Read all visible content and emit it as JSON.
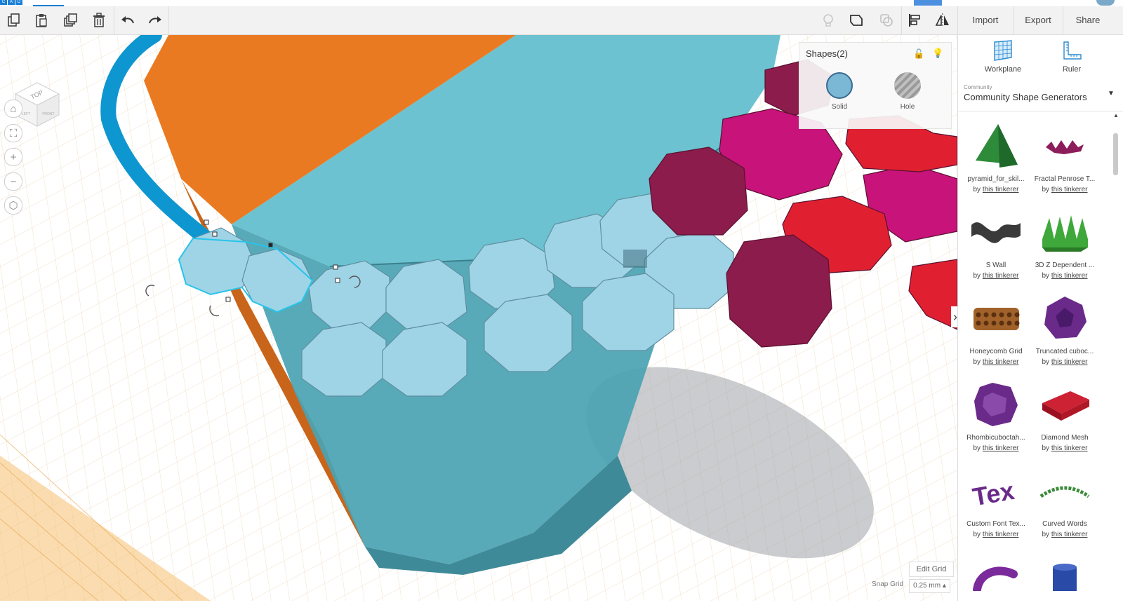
{
  "app": {
    "logo_letters": [
      "C",
      "A",
      "D"
    ]
  },
  "toolbar": {
    "copy_icon": "copy-icon",
    "paste_icon": "paste-icon",
    "duplicate_icon": "duplicate-icon",
    "delete_icon": "trash-icon",
    "undo_icon": "undo-icon",
    "redo_icon": "redo-icon",
    "import_label": "Import",
    "export_label": "Export",
    "share_label": "Share"
  },
  "viewport": {
    "viewcube_top_label": "TOP",
    "viewcube_left_label": "LEFT",
    "viewcube_front_label": "FRONT",
    "nav": [
      "home-icon",
      "fit-icon",
      "zoom-in-icon",
      "zoom-out-icon",
      "perspective-icon"
    ]
  },
  "inspector": {
    "title": "Shapes(2)",
    "solid_label": "Solid",
    "hole_label": "Hole",
    "solid_color": "#7ab8d6",
    "hole_color": "#a8a8a8"
  },
  "grid": {
    "edit_grid_label": "Edit Grid",
    "snap_grid_label": "Snap Grid",
    "snap_grid_value": "0.25 mm ▴"
  },
  "panel": {
    "workplane_label": "Workplane",
    "ruler_label": "Ruler",
    "category_small": "Community",
    "category_title": "Community Shape Generators",
    "shapes": [
      {
        "name": "pyramid_for_skil...",
        "by": "by",
        "author": "this tinkerer",
        "color": "#2e8b3a",
        "kind": "pyramid"
      },
      {
        "name": "Fractal Penrose T...",
        "by": "by",
        "author": "this tinkerer",
        "color": "#8c1c5a",
        "kind": "fractal"
      },
      {
        "name": "S Wall",
        "by": "by",
        "author": "this tinkerer",
        "color": "#3a3a3a",
        "kind": "swall"
      },
      {
        "name": "3D Z Dependent ...",
        "by": "by",
        "author": "this tinkerer",
        "color": "#3fa83a",
        "kind": "zwave"
      },
      {
        "name": "Honeycomb Grid",
        "by": "by",
        "author": "this tinkerer",
        "color": "#a0622a",
        "kind": "honey"
      },
      {
        "name": "Truncated cuboc...",
        "by": "by",
        "author": "this tinkerer",
        "color": "#6a2a8a",
        "kind": "trunc"
      },
      {
        "name": "Rhombicuboctah...",
        "by": "by",
        "author": "this tinkerer",
        "color": "#6a2a8a",
        "kind": "rhomb"
      },
      {
        "name": "Diamond Mesh",
        "by": "by",
        "author": "this tinkerer",
        "color": "#cc2233",
        "kind": "mesh"
      },
      {
        "name": "Custom Font Tex...",
        "by": "by",
        "author": "this tinkerer",
        "color": "#6a2a8a",
        "kind": "text"
      },
      {
        "name": "Curved Words",
        "by": "by",
        "author": "this tinkerer",
        "color": "#3a8a3a",
        "kind": "curved"
      },
      {
        "name": "",
        "by": "",
        "author": "",
        "color": "#7a2a9a",
        "kind": "pipe"
      },
      {
        "name": "",
        "by": "",
        "author": "",
        "color": "#2a4aa8",
        "kind": "cyl"
      }
    ]
  },
  "colors": {
    "toolbar_bg": "#f2f2f2",
    "accent": "#1a7fd6",
    "teal": "#6cc2d0",
    "orange": "#ea7a22",
    "magenta": "#c8137a",
    "red": "#e02030",
    "maroon": "#8c1c4c"
  }
}
